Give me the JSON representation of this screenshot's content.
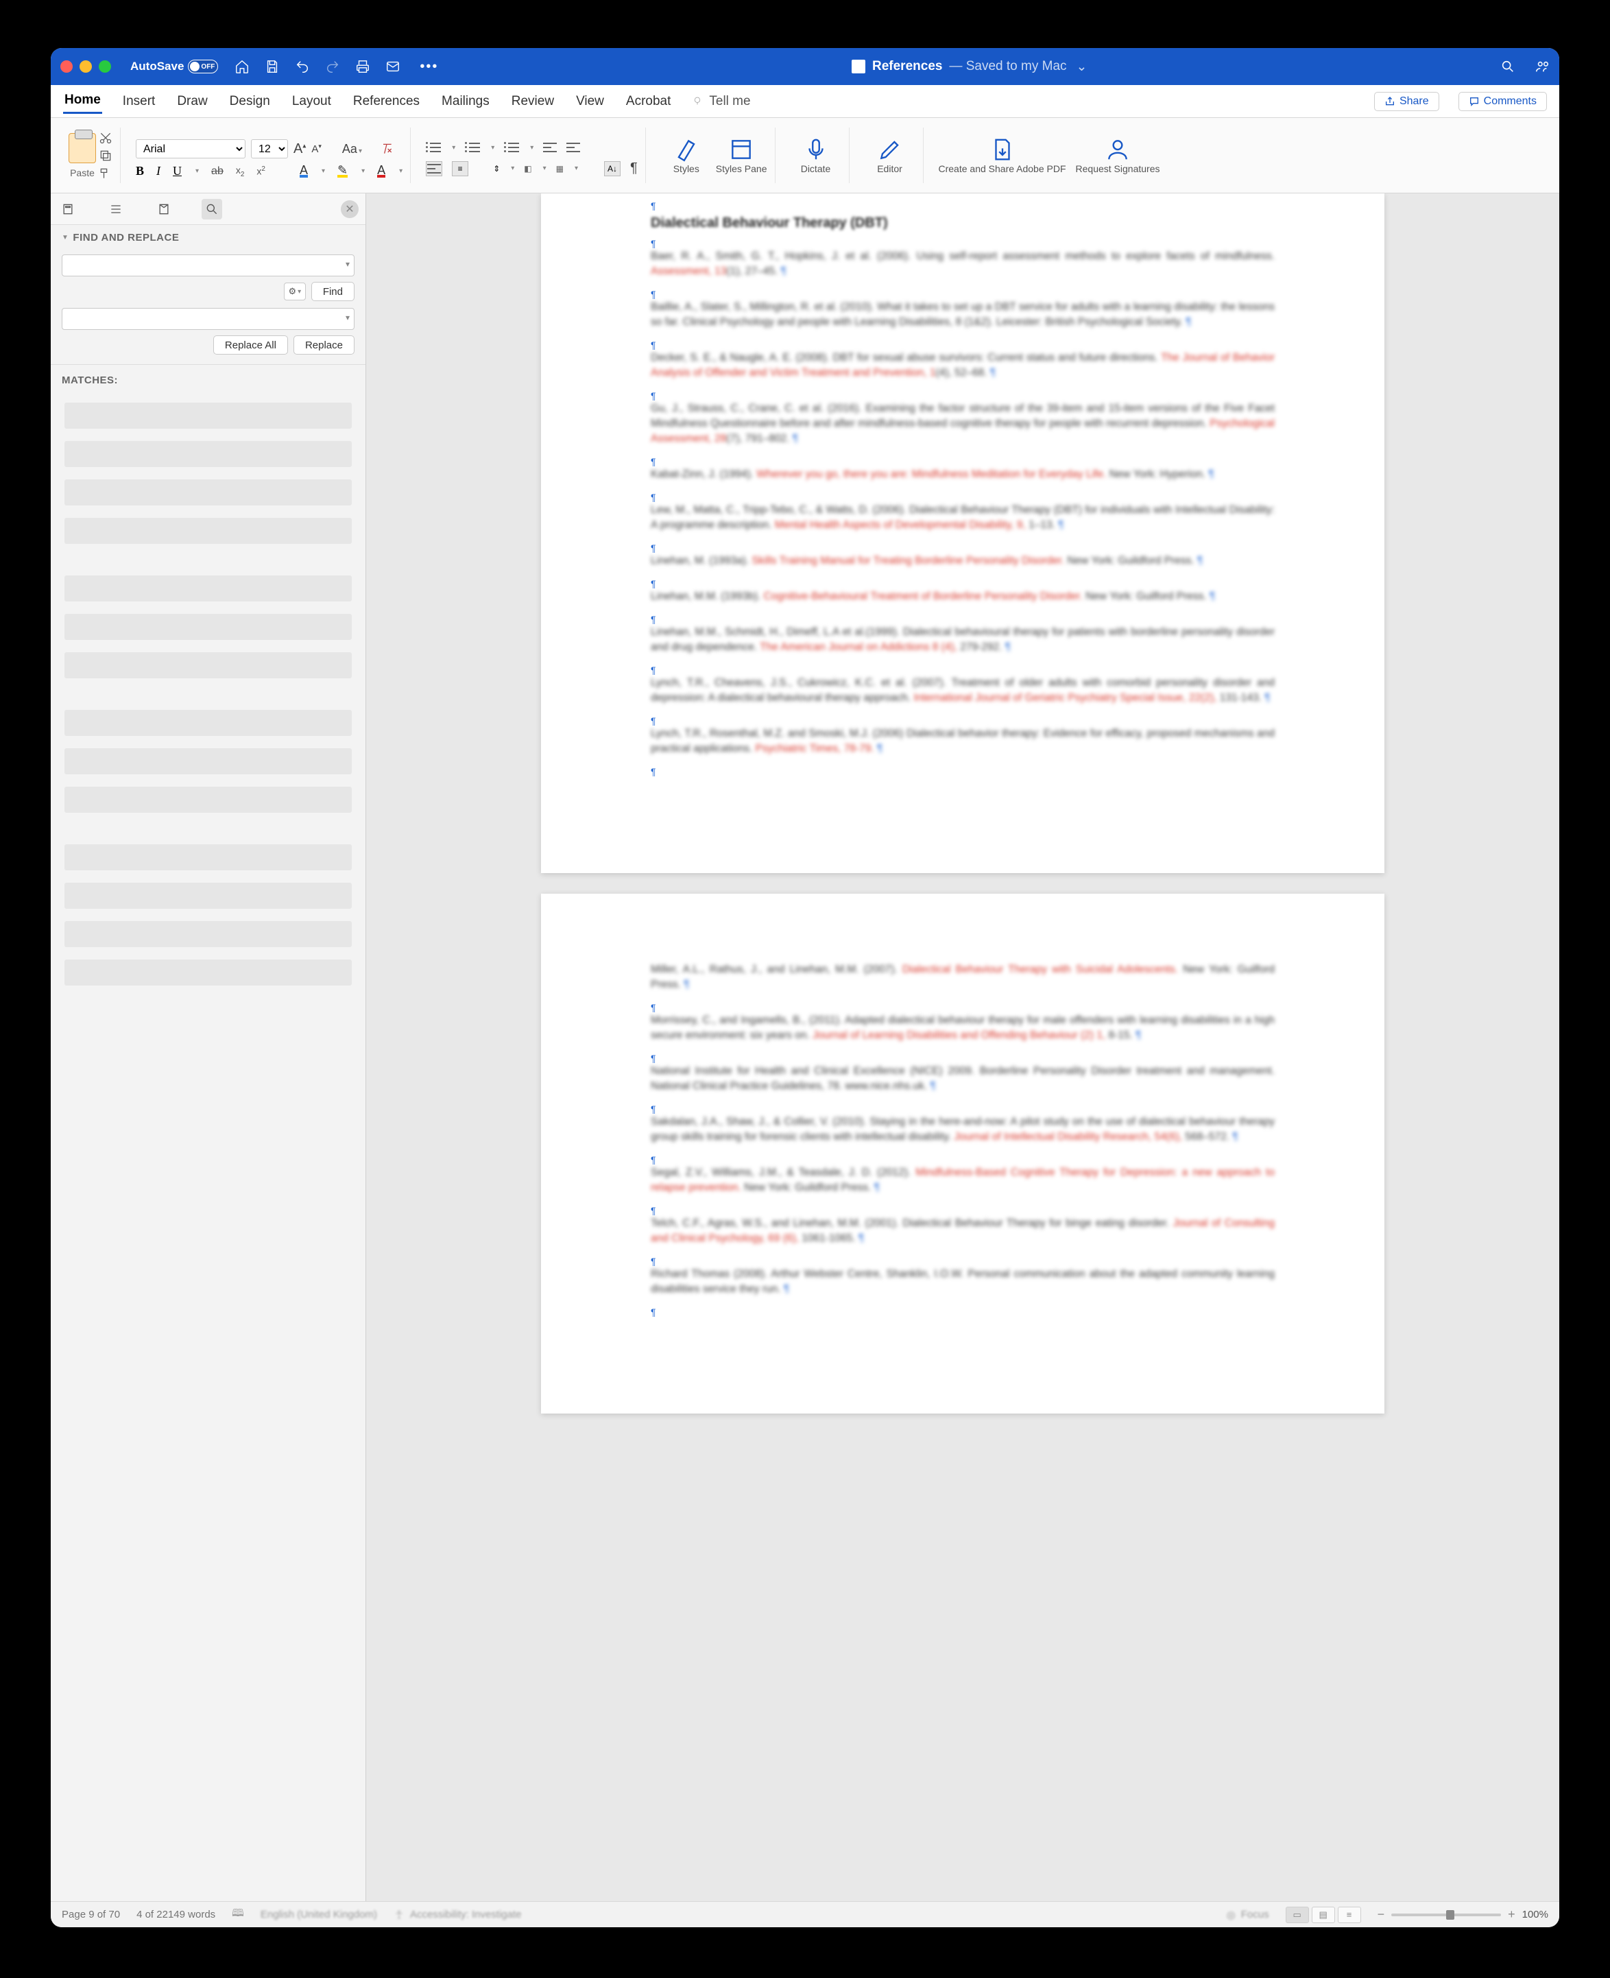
{
  "titlebar": {
    "autosave_label": "AutoSave",
    "autosave_state": "OFF",
    "doc_name": "References",
    "doc_subtitle": "— Saved to my Mac"
  },
  "tabs": {
    "items": [
      "Home",
      "Insert",
      "Draw",
      "Design",
      "Layout",
      "References",
      "Mailings",
      "Review",
      "View",
      "Acrobat"
    ],
    "active": "Home",
    "tellme": "Tell me",
    "share": "Share",
    "comments": "Comments"
  },
  "ribbon": {
    "paste": "Paste",
    "font_name": "Arial",
    "font_size": "12",
    "styles": "Styles",
    "styles_pane": "Styles Pane",
    "dictate": "Dictate",
    "editor": "Editor",
    "adobe": "Create and Share Adobe PDF",
    "signatures": "Request Signatures"
  },
  "sidebar": {
    "fnr_title": "FIND AND REPLACE",
    "find_btn": "Find",
    "replace_all": "Replace All",
    "replace": "Replace",
    "matches_label": "MATCHES:"
  },
  "document": {
    "heading": "Dialectical Behaviour Therapy (DBT)",
    "refs_page1": [
      {
        "plain": "Baer, R. A., Smith, G. T., Hopkins, J. et al. (2006). Using self-report assessment methods to explore facets of mindfulness. ",
        "red": "Assessment, 13",
        "tail": "(1), 27–45."
      },
      {
        "plain": "Baillie, A., Slater, S., Millington, R. et al. (2010). What it takes to set up a DBT service for adults with a learning disability: the lessons so far. Clinical Psychology and people with Learning Disabilities, 8 (1&2). Leicester: British Psychological Society.",
        "red": "",
        "tail": ""
      },
      {
        "plain": "Decker, S. E., & Naugle, A. E. (2008). DBT for sexual abuse survivors: Current status and future directions. ",
        "red": "The Journal of Behavior Analysis of Offender and Victim Treatment and Prevention, 1",
        "tail": "(4), 52–68."
      },
      {
        "plain": "Gu, J., Strauss, C., Crane, C. et al. (2016). Examining the factor structure of the 39-item and 15-item versions of the Five Facet Mindfulness Questionnaire before and after mindfulness-based cognitive therapy for people with recurrent depression. ",
        "red": "Psychological Assessment, 28",
        "tail": "(7), 791–802."
      },
      {
        "plain": "Kabat-Zinn, J. (1994). ",
        "red": "Wherever you go, there you are: Mindfulness Meditation for Everyday Life.",
        "tail": " New York: Hyperion."
      },
      {
        "plain": "Lew, M., Matta, C., Tripp-Tebo, C., & Watts, D. (2006). Dialectical Behaviour Therapy (DBT) for individuals with Intellectual Disability: A programme description. ",
        "red": "Mental Health Aspects of Developmental Disability, 9,",
        "tail": " 1–13."
      },
      {
        "plain": "Linehan, M. (1993a). ",
        "red": "Skills Training Manual for Treating Borderline Personality Disorder.",
        "tail": " New York: Guildford Press."
      },
      {
        "plain": "Linehan, M.M. (1993b). ",
        "red": "Cognitive-Behavioural Treatment of Borderline Personality Disorder.",
        "tail": " New York: Guilford Press."
      },
      {
        "plain": "Linehan, M.M., Schmidt, H., Dimeff, L.A et al.(1999). Dialectical behavioural therapy for patients with borderline personality disorder and drug dependence. ",
        "red": "The American Journal on Addictions 8 (4),",
        "tail": " 279-292."
      },
      {
        "plain": "Lynch, T.R., Cheavens, J.S., Cukrowicz, K.C. et al. (2007). Treatment of older adults with comorbid personality disorder and depression: A dialectical behavioural therapy approach. ",
        "red": "International Journal of Geriatric Psychiatry Special Issue, 22(2),",
        "tail": " 131-143."
      },
      {
        "plain": "Lynch, T.R., Rosenthal, M.Z. and Smoski, M.J. (2006) Dialectical behavior therapy: Evidence for efficacy, proposed mechanisms and practical applications. ",
        "red": "Psychiatric Times, 78-79.",
        "tail": ""
      }
    ],
    "refs_page2": [
      {
        "plain": "Miller, A.L., Rathus, J., and Linehan, M.M. (2007). ",
        "red": "Dialectical Behaviour Therapy with Suicidal Adolescents.",
        "tail": " New York: Guilford Press."
      },
      {
        "plain": "Morrissey, C., and Ingamells, B., (2011). Adapted dialectical behaviour therapy for male offenders with learning disabilities in a high secure environment: six years on. ",
        "red": "Journal of Learning Disabilities and Offending Behaviour (2) 1,",
        "tail": " 8-15."
      },
      {
        "plain": "National Institute for Health and Clinical Excellence (NICE) 2009. Borderline Personality Disorder treatment and management. National Clinical Practice Guidelines, 78. www.nice.nhs.uk.",
        "red": "",
        "tail": ""
      },
      {
        "plain": "Sakdalan, J.A., Shaw, J., & Collier, V. (2010). Staying in the here-and-now: A pilot study on the use of dialectical behaviour therapy group skills training for forensic clients with intellectual disability. ",
        "red": "Journal of Intellectual Disability Research, 54(6),",
        "tail": " 568–572."
      },
      {
        "plain": "Segal, Z.V., Williams, J.M., & Teasdale, J. D. (2012). ",
        "red": "Mindfulness-Based Cognitive Therapy for Depression: a new approach to relapse prevention.",
        "tail": " New York: Guildford Press."
      },
      {
        "plain": "Telch, C.F., Agras, W.S., and Linehan, M.M. (2001). Dialectical Behaviour Therapy for binge eating disorder. ",
        "red": "Journal of Consulting and Clinical Psychology, 69 (6),",
        "tail": " 1061-1065."
      },
      {
        "plain": "Richard Thomas (2008). Arthur Webster Centre, Shanklin, I.O.W. Personal communication about the adapted community learning disabilities service they run.",
        "red": "",
        "tail": ""
      }
    ]
  },
  "status": {
    "page": "Page 9 of 70",
    "words": "4 of 22149 words",
    "lang": "English (United Kingdom)",
    "access": "Accessibility: Investigate",
    "focus": "Focus",
    "zoom": "100%"
  }
}
